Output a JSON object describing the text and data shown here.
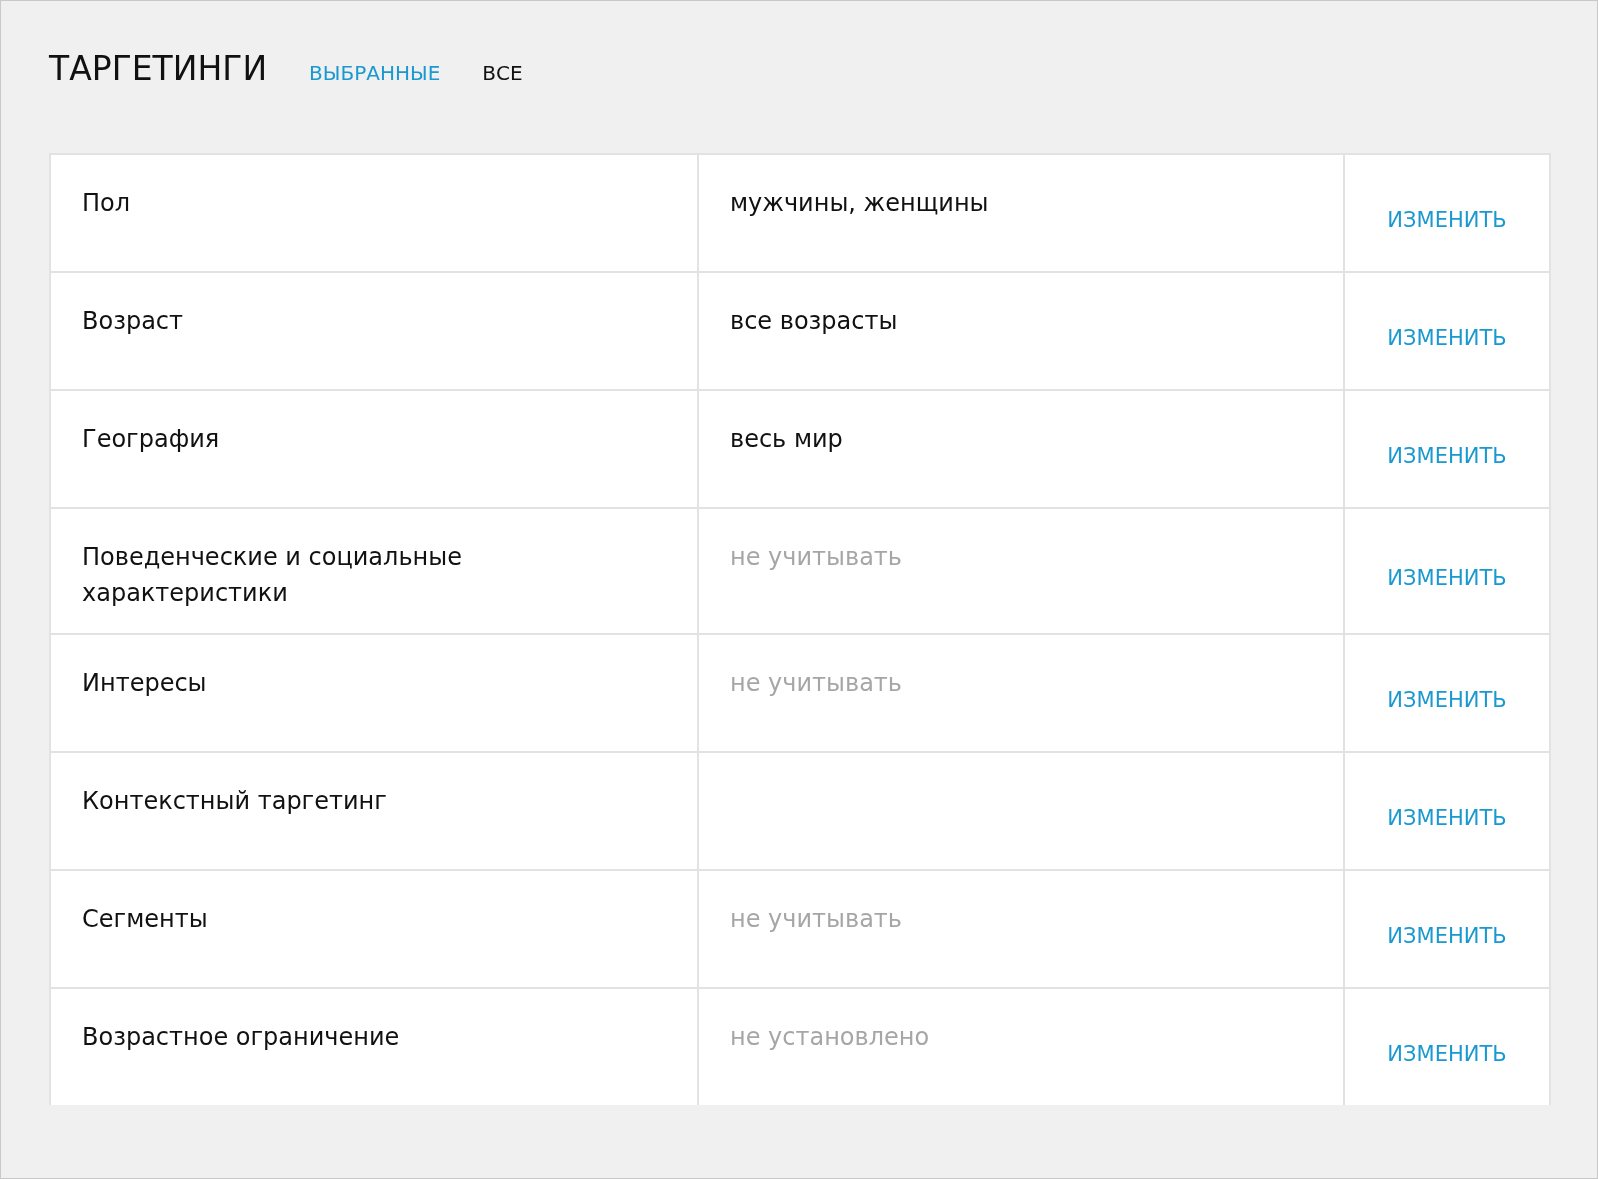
{
  "title": "ТАРГЕТИНГИ",
  "tabs": [
    {
      "label": "ВЫБРАННЫЕ",
      "selected": true
    },
    {
      "label": "ВСЕ",
      "selected": false
    }
  ],
  "rows": [
    {
      "name": "Пол",
      "value": "мужчины, женщины",
      "muted": false,
      "action": "ИЗМЕНИТЬ"
    },
    {
      "name": "Возраст",
      "value": "все возрасты",
      "muted": false,
      "action": "ИЗМЕНИТЬ"
    },
    {
      "name": "География",
      "value": "весь мир",
      "muted": false,
      "action": "ИЗМЕНИТЬ"
    },
    {
      "name": "Поведенческие и социальные характеристики",
      "value": "не учитывать",
      "muted": true,
      "action": "ИЗМЕНИТЬ"
    },
    {
      "name": "Интересы",
      "value": "не учитывать",
      "muted": true,
      "action": "ИЗМЕНИТЬ"
    },
    {
      "name": "Контекстный таргетинг",
      "action": "ИЗМЕНИТЬ"
    },
    {
      "name": "Сегменты",
      "value": "не учитывать",
      "muted": true,
      "action": "ИЗМЕНИТЬ"
    },
    {
      "name": "Возрастное ограничение",
      "value": "не установлено",
      "muted": true,
      "action": "ИЗМЕНИТЬ"
    }
  ]
}
